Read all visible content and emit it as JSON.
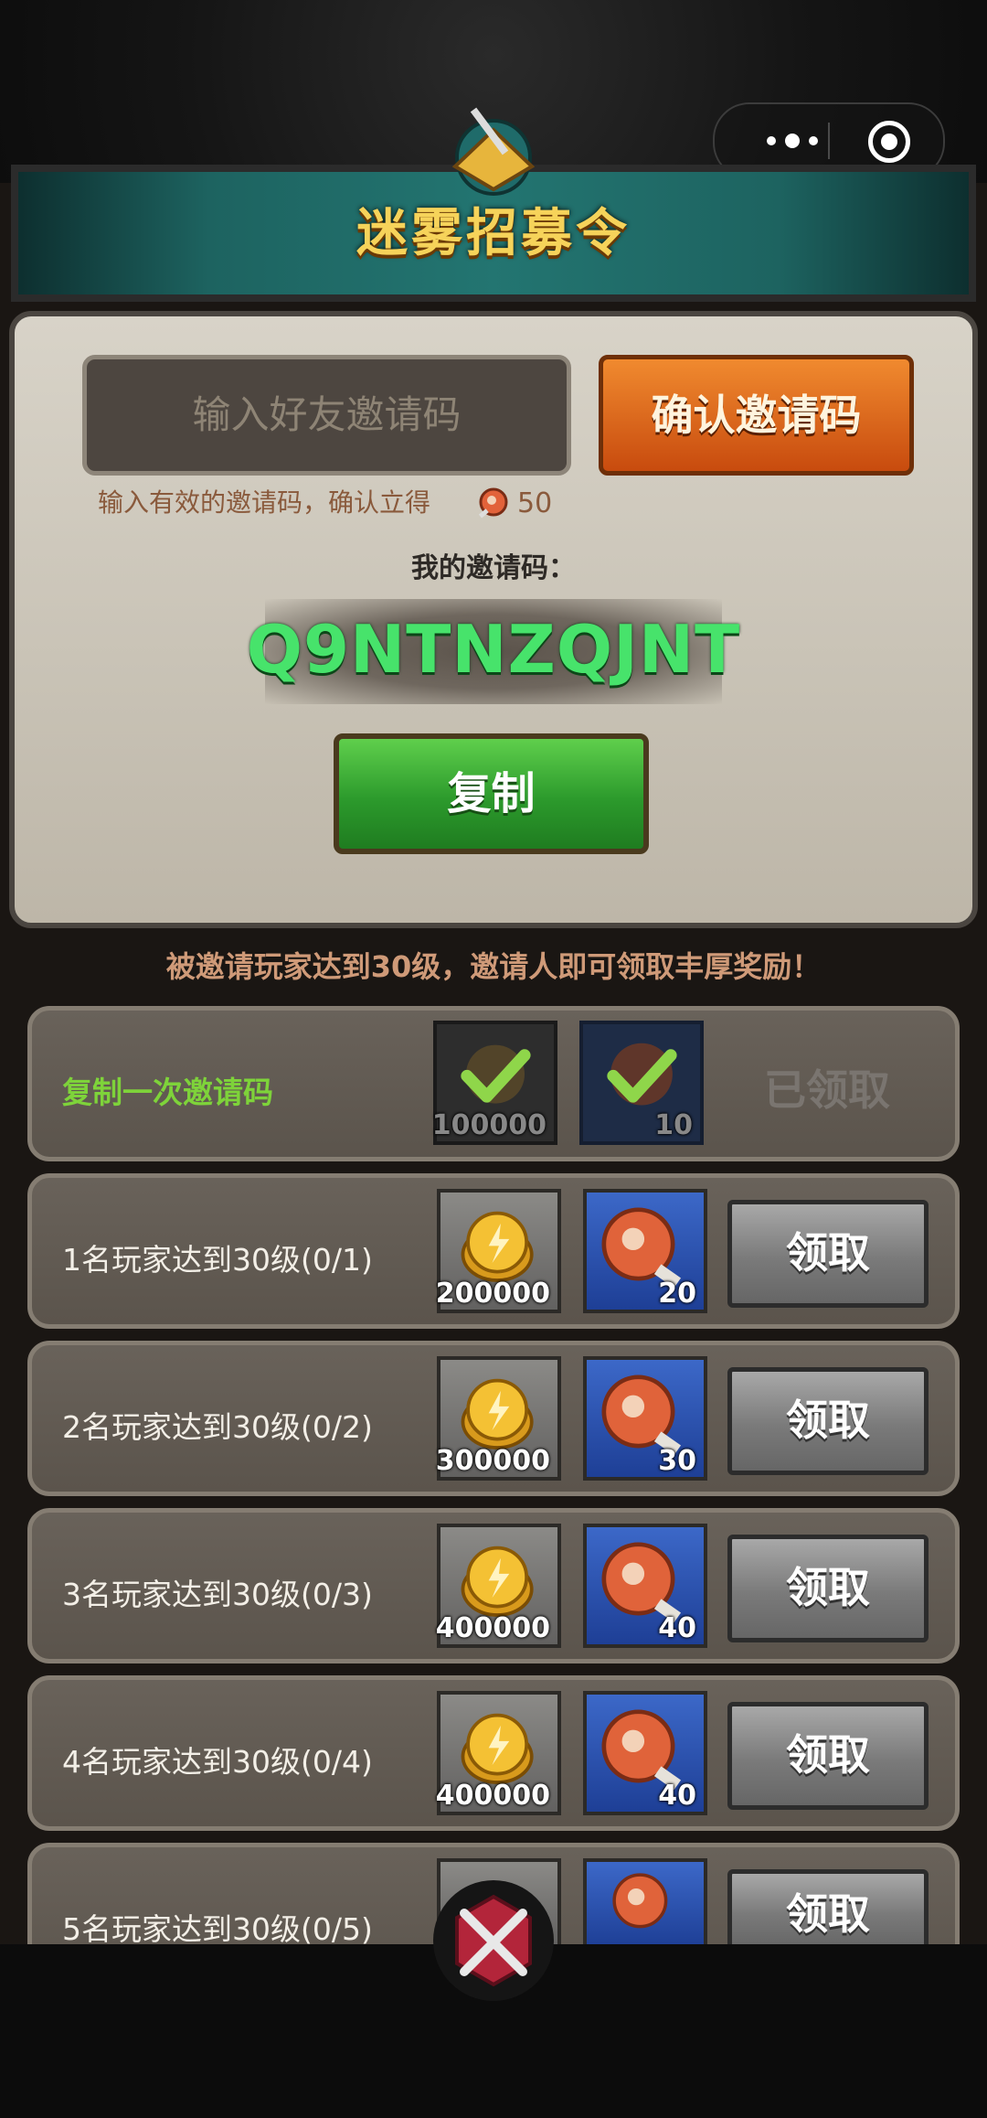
{
  "title": "迷雾招募令",
  "invite": {
    "input_placeholder": "输入好友邀请码",
    "confirm_label": "确认邀请码",
    "hint": "输入有效的邀请码，确认立得",
    "hint_reward_qty": "50",
    "my_code_label": "我的邀请码：",
    "my_code": "Q9NTNZQJNT",
    "copy_label": "复制"
  },
  "notice": "被邀请玩家达到30级，邀请人即可领取丰厚奖励！",
  "tasks": [
    {
      "label": "复制一次邀请码",
      "gold": "100000",
      "meat": "10",
      "action": "已领取"
    },
    {
      "label": "1名玩家达到30级(0/1)",
      "gold": "200000",
      "meat": "20",
      "action": "领取"
    },
    {
      "label": "2名玩家达到30级(0/2)",
      "gold": "300000",
      "meat": "30",
      "action": "领取"
    },
    {
      "label": "3名玩家达到30级(0/3)",
      "gold": "400000",
      "meat": "40",
      "action": "领取"
    },
    {
      "label": "4名玩家达到30级(0/4)",
      "gold": "400000",
      "meat": "40",
      "action": "领取"
    },
    {
      "label": "5名玩家达到30级(0/5)",
      "action": "领取"
    }
  ],
  "colors": {
    "accent_green": "#47e36b",
    "confirm_orange": "#e0702a",
    "copy_green": "#3cae36"
  }
}
